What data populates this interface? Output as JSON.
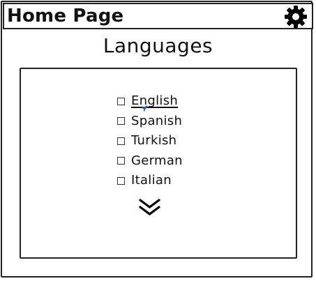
{
  "header": {
    "title": "Home Page",
    "settings_icon": "gear-icon"
  },
  "main": {
    "title": "Languages",
    "languages": [
      {
        "label": "English",
        "checked": false,
        "selected": true
      },
      {
        "label": "Spanish",
        "checked": false,
        "selected": false
      },
      {
        "label": "Turkish",
        "checked": false,
        "selected": false
      },
      {
        "label": "German",
        "checked": false,
        "selected": false
      },
      {
        "label": "Italian",
        "checked": false,
        "selected": false
      }
    ],
    "more_icon": "double-chevron-down-icon"
  },
  "colors": {
    "ink": "#111111",
    "cursor": "#2b6cb0"
  }
}
